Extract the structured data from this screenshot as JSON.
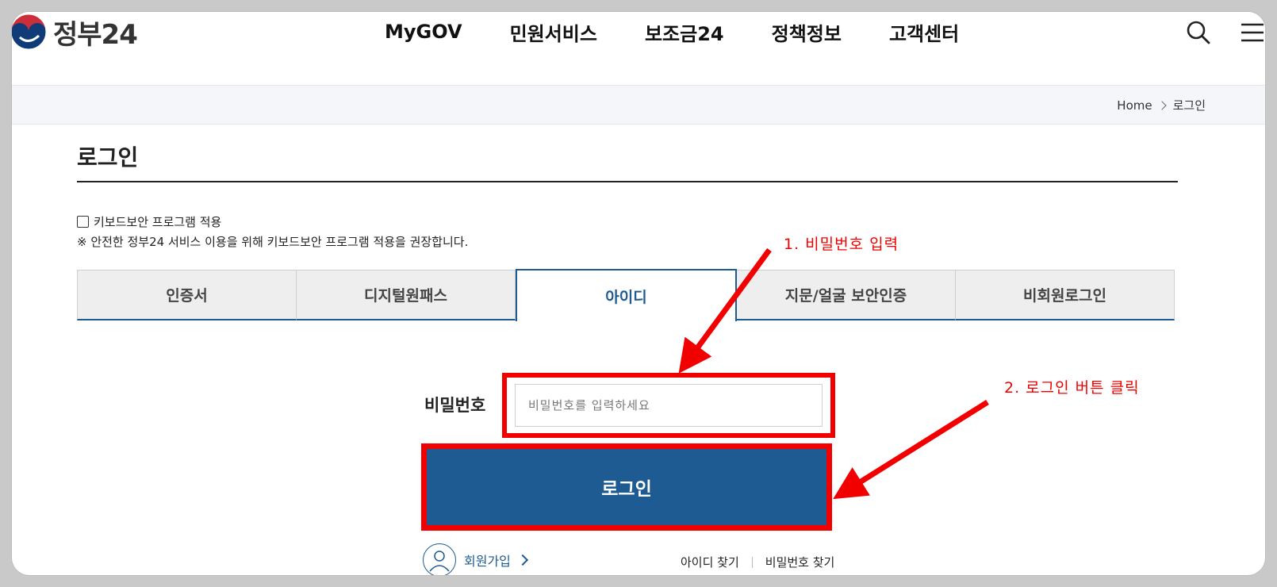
{
  "header": {
    "logo_text": "정부24",
    "nav": [
      "MyGOV",
      "민원서비스",
      "보조금24",
      "정책정보",
      "고객센터"
    ],
    "icons": {
      "search": "search-icon",
      "menu": "hamburger-menu-icon"
    }
  },
  "breadcrumb": {
    "home": "Home",
    "current": "로그인"
  },
  "page": {
    "title": "로그인",
    "keyboard_security": {
      "label": "키보드보안 프로그램 적용",
      "checked": false,
      "note": "※ 안전한 정부24 서비스 이용을 위해 키보드보안 프로그램 적용을 권장합니다."
    },
    "tabs": [
      {
        "label": "인증서",
        "active": false
      },
      {
        "label": "디지털원패스",
        "active": false
      },
      {
        "label": "아이디",
        "active": true
      },
      {
        "label": "지문/얼굴 보안인증",
        "active": false
      },
      {
        "label": "비회원로그인",
        "active": false
      }
    ],
    "form": {
      "password_label": "비밀번호",
      "password_placeholder": "비밀번호를 입력하세요",
      "password_value": "",
      "login_button": "로그인"
    },
    "links": {
      "signup": "회원가입",
      "find_id": "아이디 찾기",
      "find_password": "비밀번호 찾기"
    }
  },
  "annotations": {
    "step1": "1. 비밀번호 입력",
    "step2": "2. 로그인 버튼 클릭",
    "color": "#f20000"
  },
  "colors": {
    "brand_blue": "#1d5b92",
    "highlight_red": "#f20000",
    "logo_red": "#cd2e3a",
    "logo_navy": "#0f3b78"
  }
}
